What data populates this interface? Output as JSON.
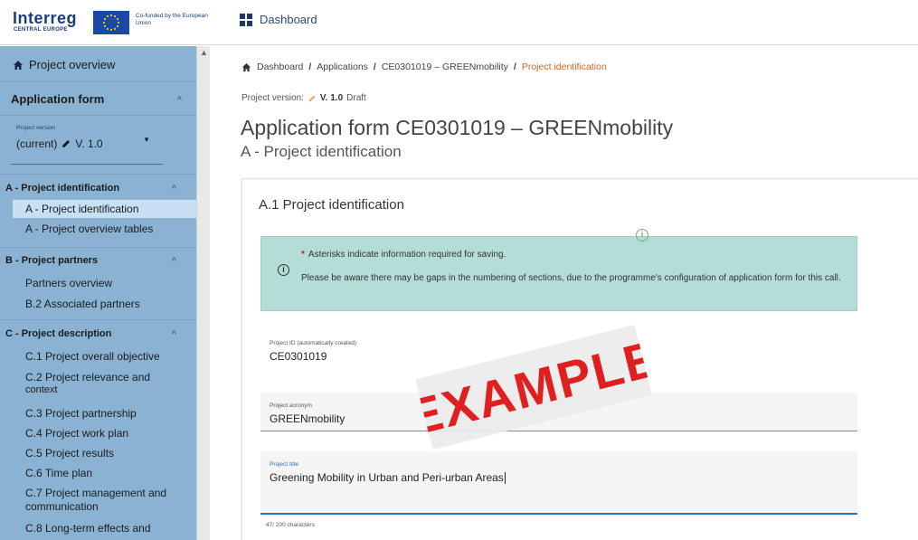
{
  "header": {
    "logo_text": "Interreg",
    "logo_sub": "CENTRAL EUROPE",
    "eu_text": "Co-funded by the European Union",
    "dashboard_label": "Dashboard"
  },
  "sidebar": {
    "project_overview_label": "Project overview",
    "application_form_label": "Application form",
    "version_small_label": "Project version",
    "version_value": "(current)",
    "version_number": "V. 1.0",
    "groups": [
      {
        "title": "A - Project identification",
        "items": [
          "A - Project identification",
          "A - Project overview tables"
        ]
      },
      {
        "title": "B - Project partners",
        "items": [
          "Partners overview",
          "B.2 Associated partners"
        ]
      },
      {
        "title": "C - Project description",
        "items": [
          "C.1 Project overall objective",
          "C.2 Project relevance and",
          "context",
          "C.3 Project partnership",
          "C.4 Project work plan",
          "C.5 Project results",
          "C.6 Time plan",
          "C.7 Project management and",
          "communication",
          "C.8 Long-term effects and"
        ]
      }
    ]
  },
  "breadcrumb": {
    "items": [
      "Dashboard",
      "Applications",
      "CE0301019 – GREENmobility"
    ],
    "current": "Project identification"
  },
  "project_version": {
    "label": "Project version:",
    "value": "V. 1.0",
    "status": "Draft"
  },
  "page": {
    "title": "Application form CE0301019 – GREENmobility",
    "subtitle": "A - Project identification"
  },
  "card": {
    "title": "A.1 Project identification",
    "info": {
      "line1": "Asterisks indicate information required for saving.",
      "line2": "Please be aware there may be gaps in the numbering of sections, due to the programme's configuration of application form for this call."
    },
    "fields": {
      "project_id_label": "Project ID (automatically created)",
      "project_id_value": "CE0301019",
      "acronym_label": "Project acronym",
      "acronym_value": "GREENmobility",
      "title_label": "Project title",
      "title_value": "Greening Mobility in Urban and Peri-urban Areas",
      "char_count": "47/ 200 characters"
    }
  },
  "stamp_text": "EXAMPLE",
  "colors": {
    "sidebar_bg": "#8ab3d3",
    "active_item": "#c8e0f4",
    "info_bg": "#b5ddd7",
    "breadcrumb_current": "#c66a2c",
    "stamp_red": "#e02020",
    "focus_blue": "#2c6fc0"
  },
  "icons": {
    "home": "home-icon",
    "dashboard": "dashboard-grid-icon",
    "pencil": "pencil-icon",
    "info": "info-circle-icon",
    "chevron": "chevron-up-icon"
  }
}
